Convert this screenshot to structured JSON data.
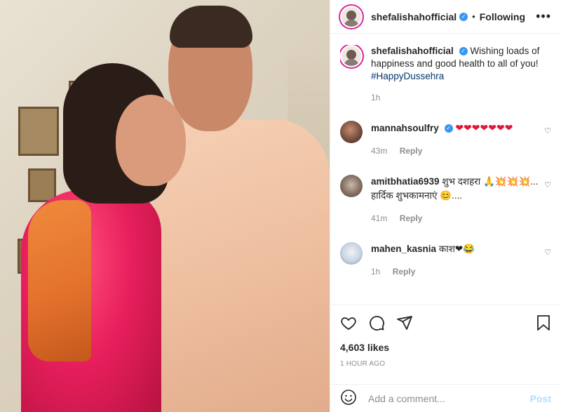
{
  "post": {
    "username": "shefalishahofficial",
    "dot": "•",
    "follow_status": "Following",
    "more_icon": "more-horizontal-icon",
    "caption_text": "Wishing loads of happiness and good health to all of you!",
    "hashtag": "#HappyDussehra",
    "caption_time": "1h"
  },
  "comments": [
    {
      "username": "mannahsoulfry",
      "text": "❤❤❤❤❤❤❤",
      "time": "43m",
      "reply": "Reply",
      "verified": true
    },
    {
      "username": "amitbhatia6939",
      "text": "शुभ दशहरा 🙏💥💥💥... हार्दिक शुभकामनाएं 😊....",
      "time": "41m",
      "reply": "Reply"
    },
    {
      "username": "mahen_kasnia",
      "text": "काश❤😂",
      "time": "1h",
      "reply": "Reply"
    }
  ],
  "actions": {
    "likes": "4,603 likes",
    "posted_ago": "1 HOUR AGO"
  },
  "add_comment": {
    "placeholder": "Add a comment...",
    "post_label": "Post"
  },
  "colors": {
    "accent_blue": "#3897f0",
    "post_disabled": "#b2dffc",
    "heart_red": "#e0173a"
  }
}
